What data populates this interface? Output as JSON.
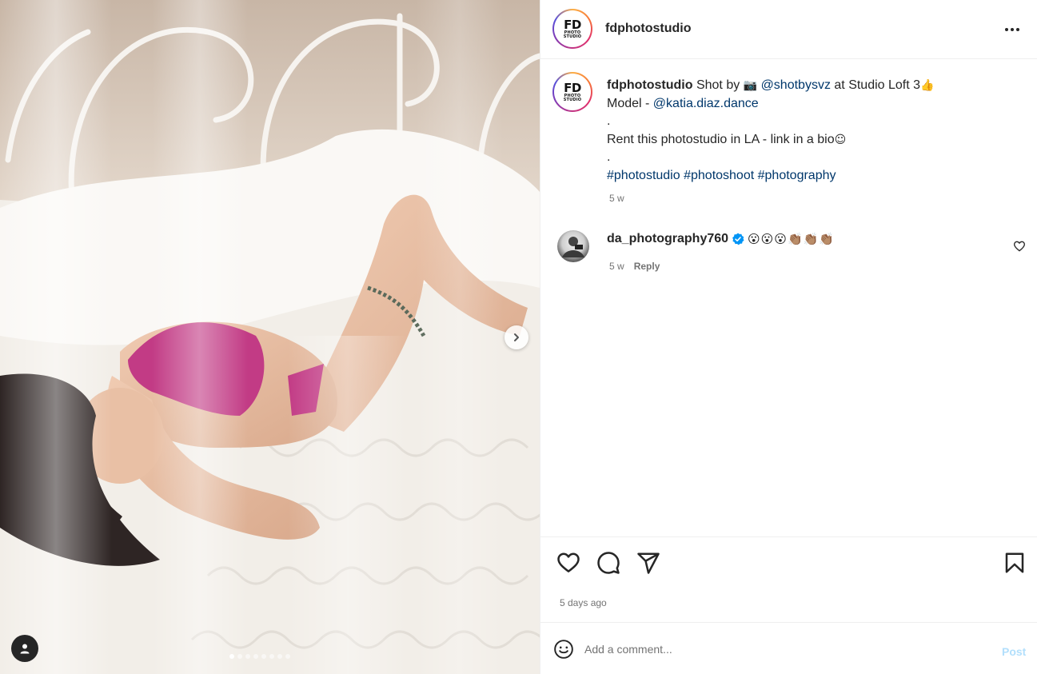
{
  "post": {
    "username": "fdphotostudio",
    "avatar_logo_main": "FD",
    "avatar_logo_sub1": "PHOTO",
    "avatar_logo_sub2": "STUDIO",
    "more_icon": "more-horizontal-icon"
  },
  "caption": {
    "username": "fdphotostudio",
    "part1": " Shot by ",
    "camera_emoji": "📷",
    "mention_photographer": "@shotbysvz",
    "part2": " at Studio Loft 3",
    "thumbs_emoji": "👍",
    "model_prefix": "Model - ",
    "mention_model": "@katia.diaz.dance",
    "dot1": ".",
    "line_rent": "Rent this photostudio in LA - link in a bio",
    "smile_emoji": "☺",
    "dot2": ".",
    "hashtag1": "#photostudio",
    "hashtag2": "#photoshoot",
    "hashtag3": "#photography",
    "time": "5 w"
  },
  "comments": [
    {
      "username": "da_photography760",
      "verified": true,
      "text": "😮😮😮👏🏽👏🏽👏🏽",
      "time": "5 w",
      "reply_label": "Reply"
    }
  ],
  "actions": {
    "like_icon": "heart-icon",
    "comment_icon": "comment-icon",
    "share_icon": "share-icon",
    "save_icon": "bookmark-icon",
    "time": "5 days ago"
  },
  "comment_bar": {
    "emoji_icon": "smiley-icon",
    "placeholder": "Add a comment...",
    "post_label": "Post"
  },
  "carousel": {
    "slide_count": 8,
    "active_index": 0,
    "next_icon": "chevron-right-icon",
    "tag_icon": "user-tag-icon"
  },
  "colors": {
    "link": "#00376b",
    "meta_gray": "#737373",
    "verified_blue": "#0095f6",
    "post_disabled": "#b2dffc"
  }
}
